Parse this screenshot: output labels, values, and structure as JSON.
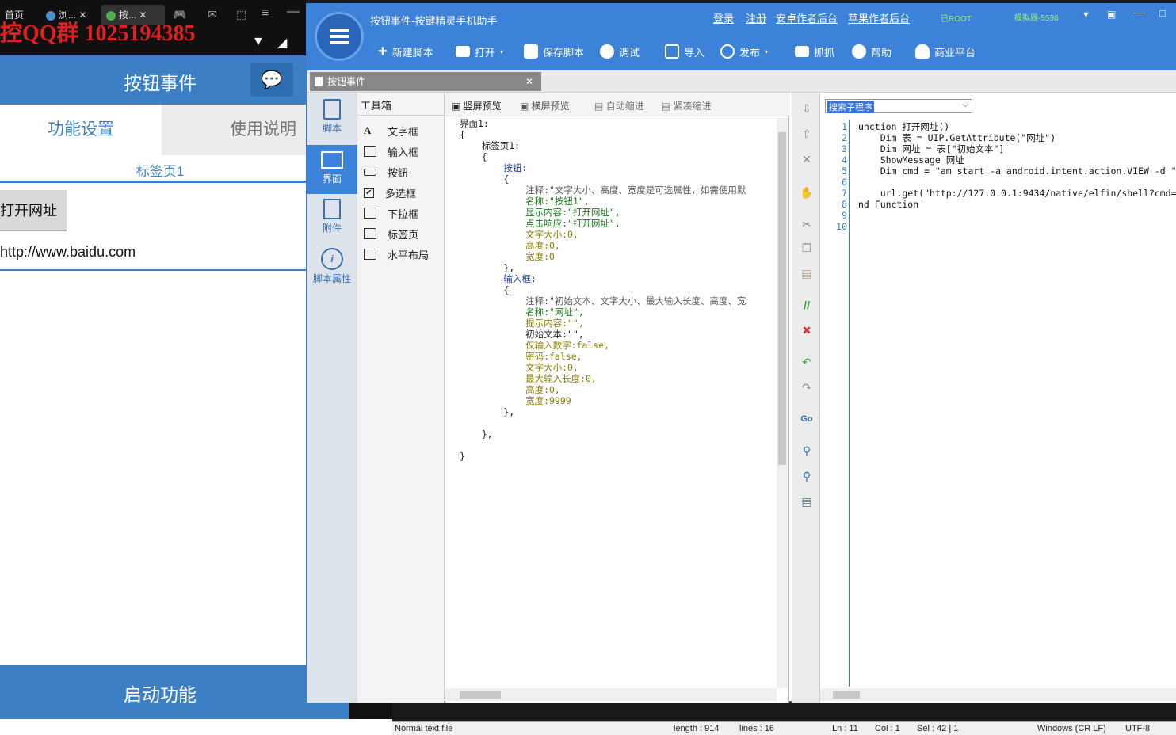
{
  "phone": {
    "tabs": [
      "首页",
      "浏...",
      "按..."
    ],
    "watermark": "控QQ群 1025194385",
    "header_title": "按钮事件",
    "tab_func": "功能设置",
    "tab_help": "使用说明",
    "page_label": "标签页1",
    "button_label": "打开网址",
    "url_value": "http://www.baidu.com",
    "footer_button": "启动功能"
  },
  "window": {
    "title": "按钮事件-按键精灵手机助手",
    "links": [
      "登录",
      "注册",
      "安卓作者后台",
      "苹果作者后台"
    ],
    "root_label": "已ROOT",
    "emulator": "模拟器-5598",
    "toolbar": [
      "新建脚本",
      "打开",
      "保存脚本",
      "调试",
      "导入",
      "发布",
      "抓抓",
      "帮助",
      "商业平台"
    ],
    "doc_tab": "按钮事件",
    "nav": [
      "脚本",
      "界面",
      "附件",
      "脚本属性"
    ],
    "toolbox_title": "工具箱",
    "toolbox": [
      "文字框",
      "输入框",
      "按钮",
      "多选框",
      "下拉框",
      "标签页",
      "水平布局"
    ],
    "preview_btns": [
      "竖屏预览",
      "横屏预览",
      "自动缩进",
      "紧凑缩进"
    ],
    "search_placeholder": "搜索子程序"
  },
  "ui_code": [
    "界面1:",
    "{",
    "    标签页1:",
    "    {",
    "        按钮:",
    "        {",
    "            注释:\"文字大小、高度、宽度是可选属性，如需使用默",
    "            名称:\"按钮1\",",
    "            显示内容:\"打开网址\",",
    "            点击响应:\"打开网址\",",
    "            文字大小:0,",
    "            高度:0,",
    "            宽度:0",
    "        },",
    "        输入框:",
    "        {",
    "            注释:\"初始文本、文字大小、最大输入长度、高度、宽",
    "            名称:\"网址\",",
    "            提示内容:\"\",",
    "            初始文本:\"\",",
    "            仅输入数字:false,",
    "            密码:false,",
    "            文字大小:0,",
    "            最大输入长度:0,",
    "            高度:0,",
    "            宽度:9999",
    "        },",
    "",
    "    },",
    "",
    "}"
  ],
  "script_code": [
    "unction 打开网址()",
    "    Dim 表 = UIP.GetAttribute(\"网址\")",
    "    Dim 网址 = 表[\"初始文本\"]",
    "    ShowMessage 网址",
    "    Dim cmd = \"am start -a android.intent.action.VIEW -d \"",
    "",
    "    url.get(\"http://127.0.0.1:9434/native/elfin/shell?cmd=",
    "nd Function",
    "",
    ""
  ],
  "line_numbers": [
    "1",
    "2",
    "3",
    "4",
    "5",
    "6",
    "7",
    "8",
    "9",
    "10"
  ],
  "status": {
    "type": "Normal text file",
    "length": "length : 914",
    "lines": "lines : 16",
    "ln": "Ln : 11",
    "col": "Col : 1",
    "sel": "Sel : 42 | 1",
    "eol": "Windows (CR LF)",
    "enc": "UTF-8"
  }
}
